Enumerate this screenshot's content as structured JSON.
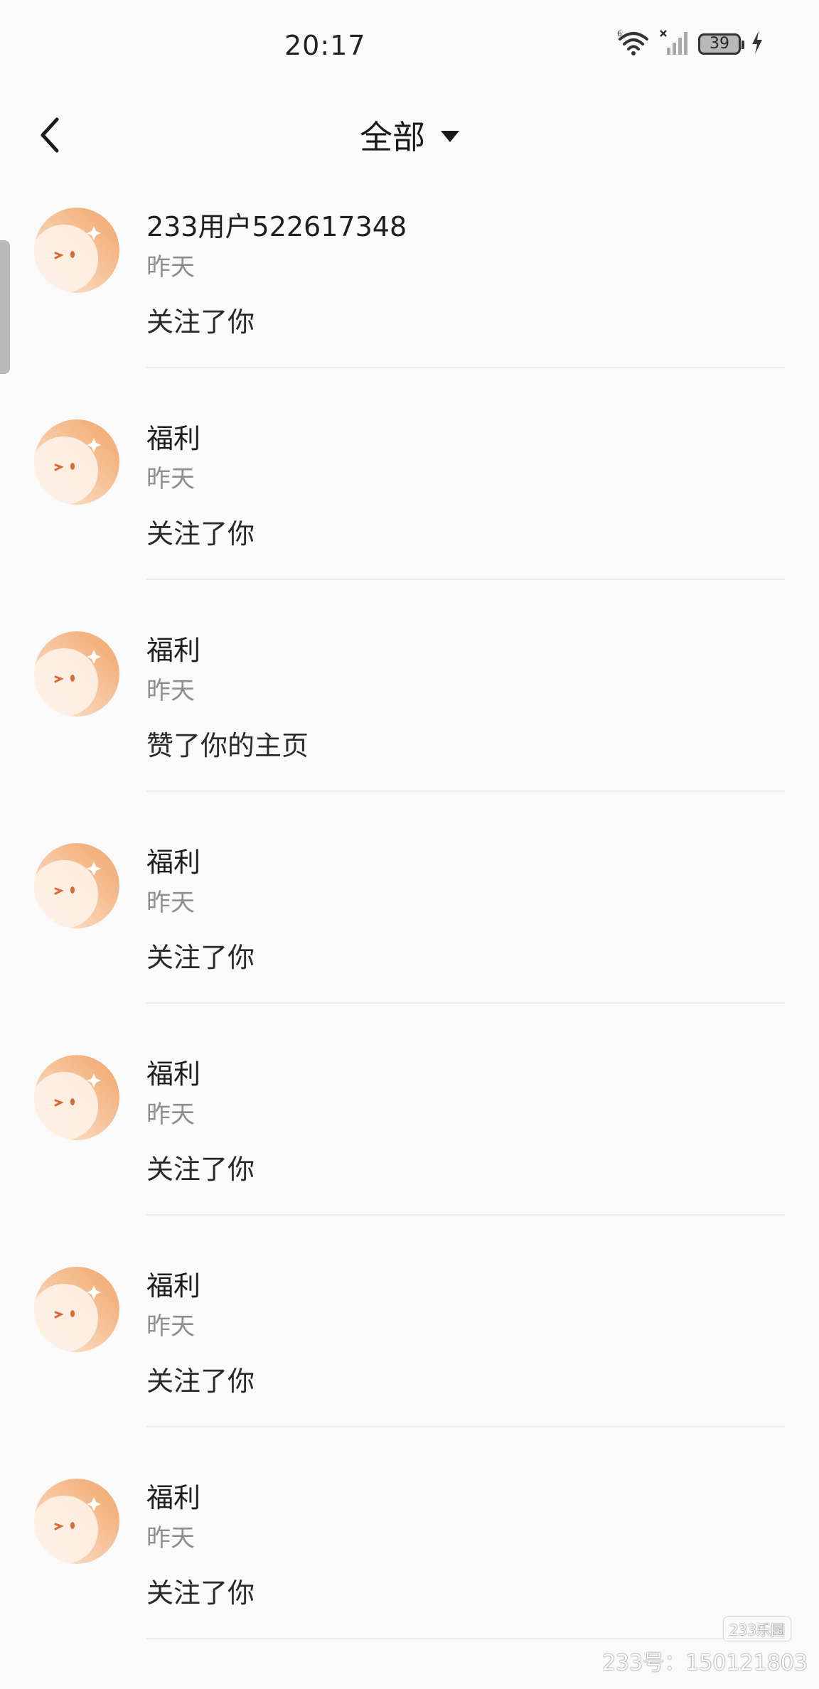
{
  "status_bar": {
    "time": "20:17",
    "battery_level": "39",
    "icons": [
      "wifi-icon",
      "signal-off-icon",
      "battery-icon",
      "charging-icon"
    ]
  },
  "header": {
    "title": "全部",
    "back_icon": "back-arrow-icon",
    "dropdown_icon": "triangle-down-icon"
  },
  "notifications": [
    {
      "name": "233用户522617348",
      "time": "昨天",
      "action": "关注了你"
    },
    {
      "name": "福利",
      "time": "昨天",
      "action": "关注了你"
    },
    {
      "name": "福利",
      "time": "昨天",
      "action": "赞了你的主页"
    },
    {
      "name": "福利",
      "time": "昨天",
      "action": "关注了你"
    },
    {
      "name": "福利",
      "time": "昨天",
      "action": "关注了你"
    },
    {
      "name": "福利",
      "time": "昨天",
      "action": "关注了你"
    },
    {
      "name": "福利",
      "time": "昨天",
      "action": "关注了你"
    }
  ],
  "watermark": {
    "logo": "233乐园",
    "id_text": "233号：150121803"
  },
  "colors": {
    "background": "#fafafb",
    "avatar_gradient_start": "#f0a468",
    "avatar_gradient_end": "#fde8d6"
  }
}
